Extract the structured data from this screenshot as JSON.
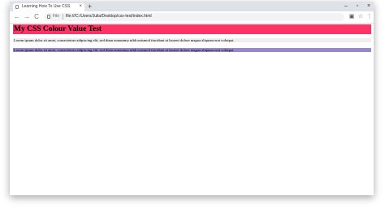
{
  "browser": {
    "tab_title": "Learning How To Use CSS",
    "tab_close": "×",
    "new_tab": "+",
    "window_controls": {
      "minimize": "–",
      "maximize": "▫",
      "close": "×"
    },
    "nav": {
      "back": "←",
      "forward": "→",
      "reload": "C"
    },
    "address": {
      "scheme_label": "File",
      "url": "file:///C:/Users/Julia/Desktop/css-test/index.html"
    },
    "toolbar_icons": {
      "translate": "▣",
      "bookmark": "☆",
      "menu": "⋮"
    }
  },
  "page": {
    "heading": "My CSS Colour Value Test",
    "paragraph_1": "Lorem ipsum dolor sit amet, consectetuer adipiscing elit, sed diam nonummy nibh euismod tincidunt ut laoreet dolore magna aliquam erat volutpat.",
    "paragraph_2": "Lorem ipsum dolor sit amet, consectetuer adipiscing elit, sed diam nonummy nibh euismod tincidunt ut laoreet dolore magna aliquam erat volutpat."
  },
  "colors": {
    "heading_background": "#ff3366",
    "paragraph_1_background": "#eeeeee",
    "paragraph_2_background": "#9988cc",
    "titlebar": "#dee1e6"
  }
}
